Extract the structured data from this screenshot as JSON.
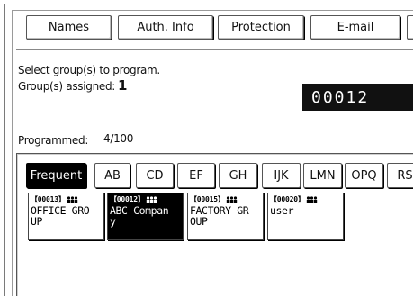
{
  "tabs": [
    {
      "label": "Names"
    },
    {
      "label": "Auth. Info"
    },
    {
      "label": "Protection"
    },
    {
      "label": "E-mail"
    }
  ],
  "instructions": {
    "line1": "Select group(s) to program.",
    "assigned_label": "Group(s) assigned:",
    "assigned_count": "1"
  },
  "registration_number": "00012",
  "programmed": {
    "label": "Programmed:",
    "value": "4/100"
  },
  "group_tabs": [
    {
      "label": "Frequent",
      "active": true
    },
    {
      "label": "AB"
    },
    {
      "label": "CD"
    },
    {
      "label": "EF"
    },
    {
      "label": "GH"
    },
    {
      "label": "IJK"
    },
    {
      "label": "LMN"
    },
    {
      "label": "OPQ"
    },
    {
      "label": "RS"
    }
  ],
  "entries": [
    {
      "number": "【00013】",
      "icon": "group-icon",
      "line1": "OFFICE GRO",
      "line2": "UP",
      "selected": false
    },
    {
      "number": "【00012】",
      "icon": "group-icon",
      "line1": "ABC Compan",
      "line2": "y",
      "selected": true
    },
    {
      "number": "【00015】",
      "icon": "group-icon",
      "line1": "FACTORY GR",
      "line2": "OUP",
      "selected": false
    },
    {
      "number": "【00020】",
      "icon": "group-icon",
      "line1": "user",
      "line2": "",
      "selected": false
    }
  ]
}
